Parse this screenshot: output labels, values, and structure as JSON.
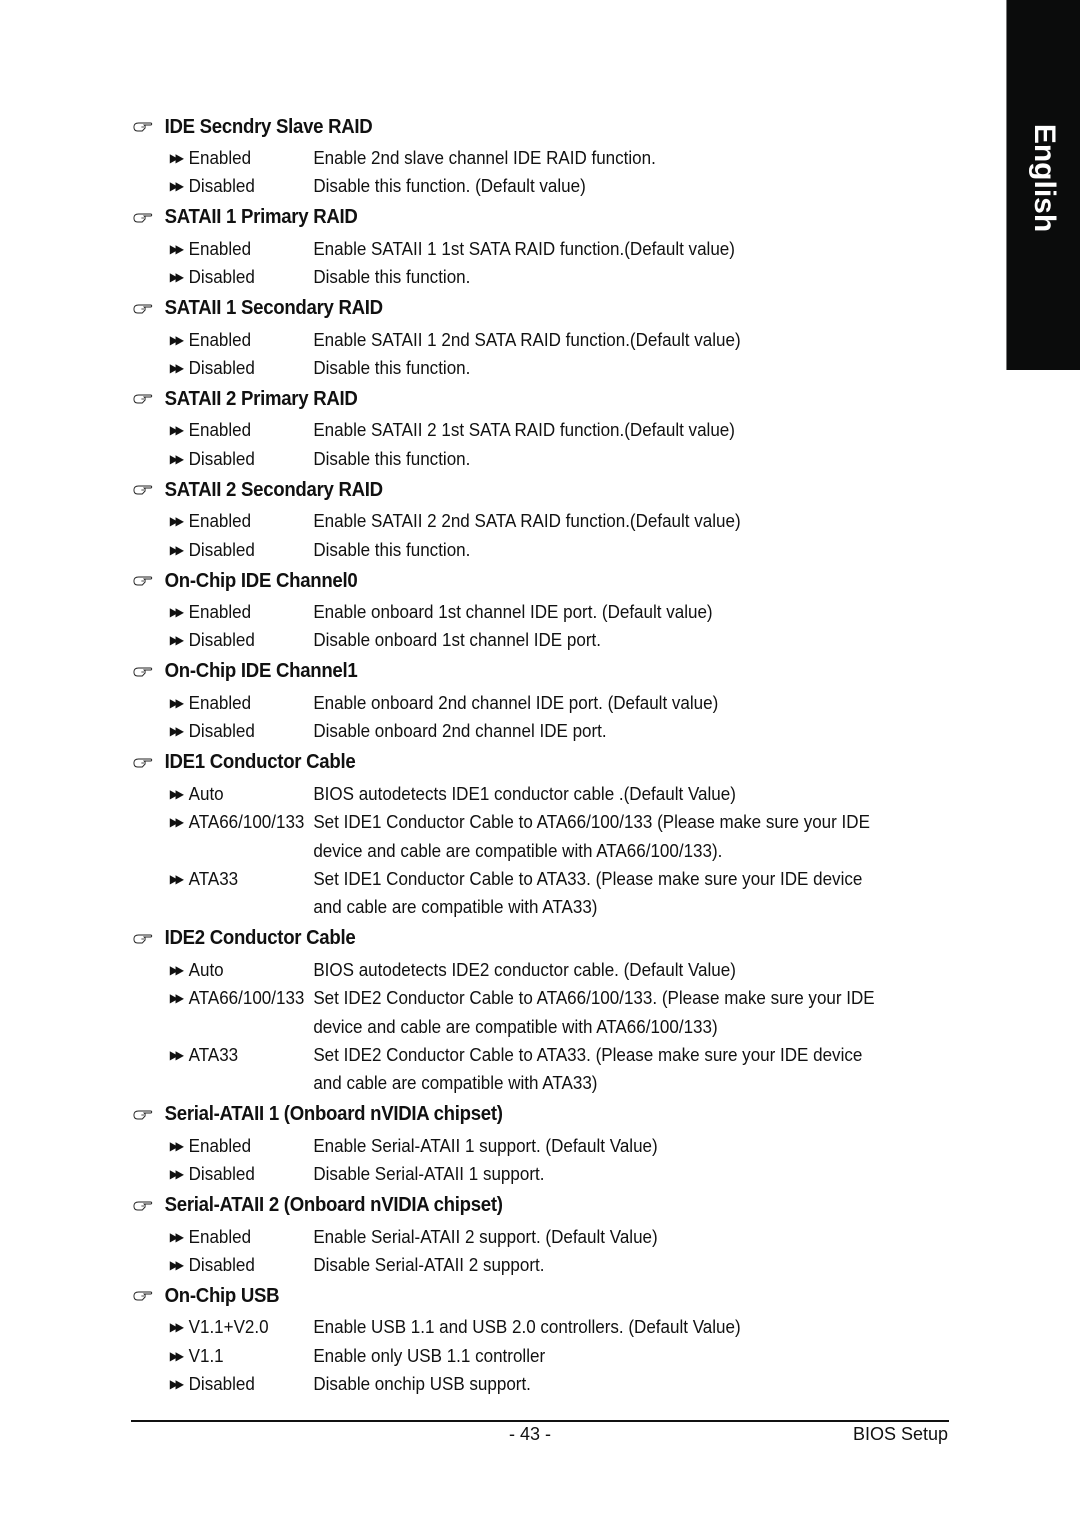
{
  "side_tab": {
    "label": "English"
  },
  "sections": [
    {
      "title": "IDE Secndry Slave RAID",
      "options": [
        {
          "name": "Enabled",
          "desc": [
            "Enable 2nd slave channel IDE RAID function."
          ]
        },
        {
          "name": "Disabled",
          "desc": [
            "Disable this function. (Default value)"
          ]
        }
      ]
    },
    {
      "title": "SATAII 1 Primary RAID",
      "options": [
        {
          "name": "Enabled",
          "desc": [
            "Enable SATAII 1 1st SATA RAID function.(Default value)"
          ]
        },
        {
          "name": "Disabled",
          "desc": [
            "Disable this function."
          ]
        }
      ]
    },
    {
      "title": "SATAII 1 Secondary RAID",
      "options": [
        {
          "name": "Enabled",
          "desc": [
            "Enable SATAII 1 2nd SATA RAID function.(Default value)"
          ]
        },
        {
          "name": "Disabled",
          "desc": [
            "Disable this function."
          ]
        }
      ]
    },
    {
      "title": "SATAII 2 Primary RAID",
      "options": [
        {
          "name": "Enabled",
          "desc": [
            "Enable SATAII 2 1st SATA RAID function.(Default value)"
          ]
        },
        {
          "name": "Disabled",
          "desc": [
            "Disable this function."
          ]
        }
      ]
    },
    {
      "title": "SATAII 2 Secondary RAID",
      "options": [
        {
          "name": "Enabled",
          "desc": [
            "Enable SATAII 2 2nd SATA RAID function.(Default value)"
          ]
        },
        {
          "name": "Disabled",
          "desc": [
            "Disable this function."
          ]
        }
      ]
    },
    {
      "title": "On-Chip IDE Channel0",
      "options": [
        {
          "name": "Enabled",
          "desc": [
            "Enable onboard 1st channel IDE port. (Default value)"
          ]
        },
        {
          "name": "Disabled",
          "desc": [
            "Disable onboard 1st channel IDE port."
          ]
        }
      ]
    },
    {
      "title": "On-Chip IDE Channel1",
      "options": [
        {
          "name": "Enabled",
          "desc": [
            "Enable onboard 2nd channel IDE port. (Default value)"
          ]
        },
        {
          "name": "Disabled",
          "desc": [
            "Disable onboard 2nd channel IDE port."
          ]
        }
      ]
    },
    {
      "title": "IDE1 Conductor Cable",
      "options": [
        {
          "name": "Auto",
          "desc": [
            "BIOS autodetects IDE1 conductor cable .(Default Value)"
          ]
        },
        {
          "name": "ATA66/100/133",
          "desc": [
            "Set IDE1 Conductor Cable to ATA66/100/133 (Please make sure your IDE",
            "device and cable are compatible with ATA66/100/133)."
          ]
        },
        {
          "name": "ATA33",
          "desc": [
            "Set IDE1 Conductor Cable to ATA33. (Please make sure your IDE device",
            "and cable are compatible with ATA33)"
          ]
        }
      ]
    },
    {
      "title": "IDE2 Conductor Cable",
      "options": [
        {
          "name": "Auto",
          "desc": [
            "BIOS autodetects IDE2 conductor cable. (Default Value)"
          ]
        },
        {
          "name": "ATA66/100/133",
          "desc": [
            "Set IDE2 Conductor Cable to ATA66/100/133. (Please make sure your IDE",
            "device and cable are compatible with ATA66/100/133)"
          ]
        },
        {
          "name": "ATA33",
          "desc": [
            "Set IDE2 Conductor Cable to ATA33. (Please make sure your IDE device",
            "and cable are compatible with ATA33)"
          ]
        }
      ]
    },
    {
      "title": "Serial-ATAII 1 (Onboard nVIDIA chipset)",
      "options": [
        {
          "name": "Enabled",
          "desc": [
            "Enable Serial-ATAII 1 support. (Default Value)"
          ]
        },
        {
          "name": "Disabled",
          "desc": [
            "Disable Serial-ATAII 1 support."
          ]
        }
      ]
    },
    {
      "title": "Serial-ATAII 2  (Onboard nVIDIA chipset)",
      "options": [
        {
          "name": "Enabled",
          "desc": [
            "Enable Serial-ATAII 2 support. (Default Value)"
          ]
        },
        {
          "name": "Disabled",
          "desc": [
            "Disable Serial-ATAII 2 support."
          ]
        }
      ]
    },
    {
      "title": "On-Chip USB",
      "options": [
        {
          "name": "V1.1+V2.0",
          "desc": [
            "Enable USB 1.1 and USB 2.0 controllers. (Default Value)"
          ]
        },
        {
          "name": "V1.1",
          "desc": [
            "Enable only USB 1.1 controller"
          ]
        },
        {
          "name": "Disabled",
          "desc": [
            "Disable onchip USB support."
          ]
        }
      ]
    }
  ],
  "footer": {
    "page_number": "- 43 -",
    "section_label": "BIOS Setup"
  },
  "icons": {
    "section_marker": "pointing-hand-icon",
    "option_marker": "double-triangle-bullet-icon"
  }
}
